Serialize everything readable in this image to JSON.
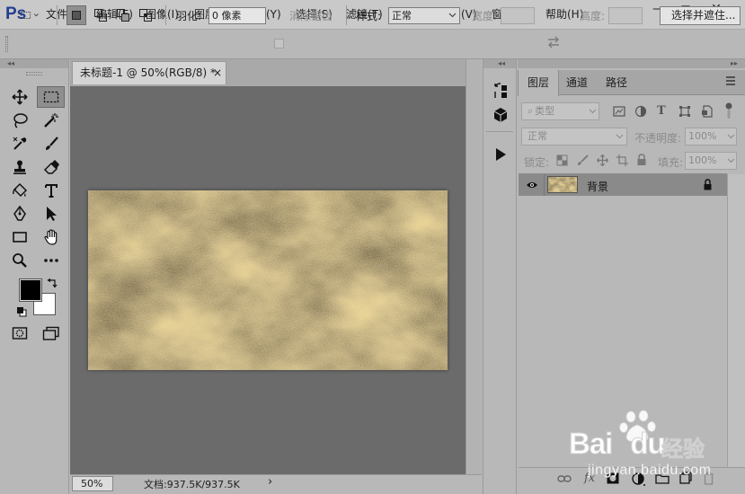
{
  "app": {
    "logo": "Ps"
  },
  "menu": [
    "文件(F)",
    "编辑(E)",
    "图像(I)",
    "图层(L)",
    "文字(Y)",
    "选择(S)",
    "滤镜(T)",
    "3D(D)",
    "视图(V)",
    "窗口(W)",
    "帮助(H)"
  ],
  "window_controls": {
    "minimize": "—",
    "maximize": "□",
    "close": "✕"
  },
  "options": {
    "feather_label": "羽化:",
    "feather_value": "0 像素",
    "antialias_label": "消除锯齿",
    "style_label": "样式:",
    "style_value": "正常",
    "width_label": "宽度:",
    "height_label": "高度:",
    "select_mask_button": "选择并遮住..."
  },
  "document": {
    "tab_title": "未标题-1 @ 50%(RGB/8) *",
    "tab_close": "×",
    "zoom": "50%",
    "doc_info": "文档:937.5K/937.5K",
    "status_arrow": "›"
  },
  "layers_panel": {
    "tabs": [
      "图层",
      "通道",
      "路径"
    ],
    "filter_kind": "类型",
    "blend_mode": "正常",
    "opacity_label": "不透明度:",
    "opacity_value": "100%",
    "lock_label": "锁定:",
    "fill_label": "填充:",
    "fill_value": "100%",
    "layers": [
      {
        "name": "背景",
        "visible": true,
        "locked": true
      }
    ],
    "bottom_icons": [
      "link-icon",
      "fx-icon",
      "mask-icon",
      "adjustment-icon",
      "group-icon",
      "new-layer-icon",
      "trash-icon"
    ],
    "fx_glyph": "fx"
  },
  "watermark": {
    "brand": "Bai",
    "brand2": "du",
    "brand_cn": "经验",
    "url": "jingyan.baidu.com"
  },
  "colors": {
    "ui_bg": "#b8b8b8",
    "canvas_bg": "#6b6b6b",
    "logo_blue": "#243f8f",
    "gold_light": "#e8d49a",
    "gold_dark": "#7a6420"
  }
}
